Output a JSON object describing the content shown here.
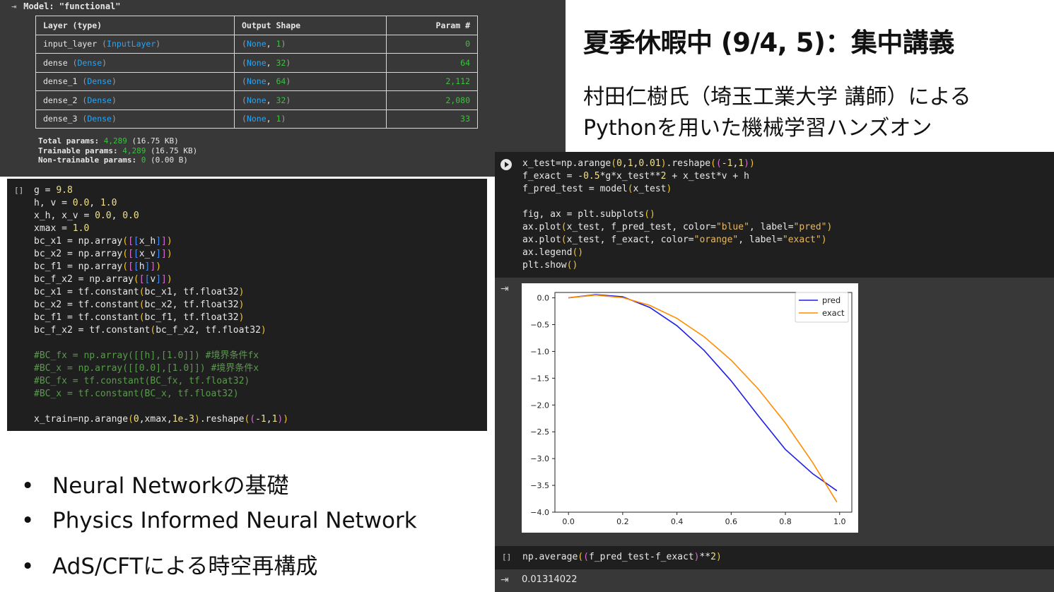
{
  "model_summary": {
    "output_icon": "output-toggle-icon",
    "header": "Model: \"functional\"",
    "columns": [
      "Layer (type)",
      "Output Shape",
      "Param #"
    ],
    "rows": [
      {
        "name": "input_layer",
        "type": "InputLayer",
        "shape_none": "None",
        "shape_dim": "1",
        "params": "0"
      },
      {
        "name": "dense",
        "type": "Dense",
        "shape_none": "None",
        "shape_dim": "32",
        "params": "64"
      },
      {
        "name": "dense_1",
        "type": "Dense",
        "shape_none": "None",
        "shape_dim": "64",
        "params": "2,112"
      },
      {
        "name": "dense_2",
        "type": "Dense",
        "shape_none": "None",
        "shape_dim": "32",
        "params": "2,080"
      },
      {
        "name": "dense_3",
        "type": "Dense",
        "shape_none": "None",
        "shape_dim": "1",
        "params": "33"
      }
    ],
    "totals": [
      {
        "label": "Total params:",
        "value": "4,289",
        "size": "(16.75 KB)"
      },
      {
        "label": "Trainable params:",
        "value": "4,289",
        "size": "(16.75 KB)"
      },
      {
        "label": "Non-trainable params:",
        "value": "0",
        "size": "(0.00 B)"
      }
    ]
  },
  "code_left": {
    "run_marker": "[]",
    "lines": [
      [
        {
          "t": "g = "
        },
        {
          "t": "9.8",
          "c": "n"
        }
      ],
      [
        {
          "t": "h, v = "
        },
        {
          "t": "0.0",
          "c": "n"
        },
        {
          "t": ", "
        },
        {
          "t": "1.0",
          "c": "n"
        }
      ],
      [
        {
          "t": "x_h, x_v = "
        },
        {
          "t": "0.0",
          "c": "n"
        },
        {
          "t": ", "
        },
        {
          "t": "0.0",
          "c": "n"
        }
      ],
      [
        {
          "t": "xmax = "
        },
        {
          "t": "1.0",
          "c": "n"
        }
      ],
      [
        {
          "t": "bc_x1 = np.array"
        },
        {
          "t": "(",
          "c": "p1"
        },
        {
          "t": "[",
          "c": "p2"
        },
        {
          "t": "[",
          "c": "p3"
        },
        {
          "t": "x_h"
        },
        {
          "t": "]",
          "c": "p3"
        },
        {
          "t": "]",
          "c": "p2"
        },
        {
          "t": ")",
          "c": "p1"
        }
      ],
      [
        {
          "t": "bc_x2 = np.array"
        },
        {
          "t": "(",
          "c": "p1"
        },
        {
          "t": "[",
          "c": "p2"
        },
        {
          "t": "[",
          "c": "p3"
        },
        {
          "t": "x_v"
        },
        {
          "t": "]",
          "c": "p3"
        },
        {
          "t": "]",
          "c": "p2"
        },
        {
          "t": ")",
          "c": "p1"
        }
      ],
      [
        {
          "t": "bc_f1 = np.array"
        },
        {
          "t": "(",
          "c": "p1"
        },
        {
          "t": "[",
          "c": "p2"
        },
        {
          "t": "[",
          "c": "p3"
        },
        {
          "t": "h"
        },
        {
          "t": "]",
          "c": "p3"
        },
        {
          "t": "]",
          "c": "p2"
        },
        {
          "t": ")",
          "c": "p1"
        }
      ],
      [
        {
          "t": "bc_f_x2 = np.array"
        },
        {
          "t": "(",
          "c": "p1"
        },
        {
          "t": "[",
          "c": "p2"
        },
        {
          "t": "[",
          "c": "p3"
        },
        {
          "t": "v"
        },
        {
          "t": "]",
          "c": "p3"
        },
        {
          "t": "]",
          "c": "p2"
        },
        {
          "t": ")",
          "c": "p1"
        }
      ],
      [
        {
          "t": "bc_x1 = tf.constant"
        },
        {
          "t": "(",
          "c": "p1"
        },
        {
          "t": "bc_x1, tf.float32"
        },
        {
          "t": ")",
          "c": "p1"
        }
      ],
      [
        {
          "t": "bc_x2 = tf.constant"
        },
        {
          "t": "(",
          "c": "p1"
        },
        {
          "t": "bc_x2, tf.float32"
        },
        {
          "t": ")",
          "c": "p1"
        }
      ],
      [
        {
          "t": "bc_f1 = tf.constant"
        },
        {
          "t": "(",
          "c": "p1"
        },
        {
          "t": "bc_f1, tf.float32"
        },
        {
          "t": ")",
          "c": "p1"
        }
      ],
      [
        {
          "t": "bc_f_x2 = tf.constant"
        },
        {
          "t": "(",
          "c": "p1"
        },
        {
          "t": "bc_f_x2, tf.float32"
        },
        {
          "t": ")",
          "c": "p1"
        }
      ],
      [],
      [
        {
          "t": "#BC_fx = np.array([[h],[1.0]]) #境界条件fx",
          "c": "cm"
        }
      ],
      [
        {
          "t": "#BC_x = np.array([[0.0],[1.0]]) #境界条件x",
          "c": "cm"
        }
      ],
      [
        {
          "t": "#BC_fx = tf.constant(BC_fx, tf.float32)",
          "c": "cm"
        }
      ],
      [
        {
          "t": "#BC_x = tf.constant(BC_x, tf.float32)",
          "c": "cm"
        }
      ],
      [],
      [
        {
          "t": "x_train=np.arange"
        },
        {
          "t": "(",
          "c": "p1"
        },
        {
          "t": "0",
          "c": "n"
        },
        {
          "t": ",xmax,"
        },
        {
          "t": "1e-3",
          "c": "n"
        },
        {
          "t": ")",
          "c": "p1"
        },
        {
          "t": ".reshape"
        },
        {
          "t": "(",
          "c": "p1"
        },
        {
          "t": "(",
          "c": "p2"
        },
        {
          "t": "-1",
          "c": "n"
        },
        {
          "t": ","
        },
        {
          "t": "1",
          "c": "n"
        },
        {
          "t": ")",
          "c": "p2"
        },
        {
          "t": ")",
          "c": "p1"
        }
      ]
    ]
  },
  "title": {
    "main": "夏季休暇中 (9/4, 5)：集中講義",
    "sub1": "村田仁樹氏（埼玉工業大学 講師）による",
    "sub2": "Pythonを用いた機械学習ハンズオン"
  },
  "code_right": {
    "run_icon": "play-icon",
    "lines": [
      [
        {
          "t": "x_test=np.arange"
        },
        {
          "t": "(",
          "c": "p1"
        },
        {
          "t": "0",
          "c": "n"
        },
        {
          "t": ","
        },
        {
          "t": "1",
          "c": "n"
        },
        {
          "t": ","
        },
        {
          "t": "0.01",
          "c": "n"
        },
        {
          "t": ")",
          "c": "p1"
        },
        {
          "t": ".reshape"
        },
        {
          "t": "(",
          "c": "p1"
        },
        {
          "t": "(",
          "c": "p2"
        },
        {
          "t": "-1",
          "c": "n"
        },
        {
          "t": ","
        },
        {
          "t": "1",
          "c": "n"
        },
        {
          "t": ")",
          "c": "p2"
        },
        {
          "t": ")",
          "c": "p1"
        }
      ],
      [
        {
          "t": "f_exact = -"
        },
        {
          "t": "0.5",
          "c": "n"
        },
        {
          "t": "*g*x_test**"
        },
        {
          "t": "2",
          "c": "n"
        },
        {
          "t": " + x_test*v + h"
        }
      ],
      [
        {
          "t": "f_pred_test = model"
        },
        {
          "t": "(",
          "c": "p1"
        },
        {
          "t": "x_test"
        },
        {
          "t": ")",
          "c": "p1"
        }
      ],
      [],
      [
        {
          "t": "fig, ax = plt.subplots"
        },
        {
          "t": "()",
          "c": "p1"
        }
      ],
      [
        {
          "t": "ax.plot"
        },
        {
          "t": "(",
          "c": "p1"
        },
        {
          "t": "x_test, f_pred_test, color="
        },
        {
          "t": "\"blue\"",
          "c": "s"
        },
        {
          "t": ", label="
        },
        {
          "t": "\"pred\"",
          "c": "s"
        },
        {
          "t": ")",
          "c": "p1"
        }
      ],
      [
        {
          "t": "ax.plot"
        },
        {
          "t": "(",
          "c": "p1"
        },
        {
          "t": "x_test, f_exact, color="
        },
        {
          "t": "\"orange\"",
          "c": "s"
        },
        {
          "t": ", label="
        },
        {
          "t": "\"exact\"",
          "c": "s"
        },
        {
          "t": ")",
          "c": "p1"
        }
      ],
      [
        {
          "t": "ax.legend"
        },
        {
          "t": "()",
          "c": "p1"
        }
      ],
      [
        {
          "t": "plt.show"
        },
        {
          "t": "()",
          "c": "p1"
        }
      ]
    ],
    "output_icon": "output-toggle-icon"
  },
  "chart_data": {
    "type": "line",
    "title": "",
    "xlabel": "",
    "ylabel": "",
    "xlim": [
      -0.05,
      1.045
    ],
    "ylim": [
      -4.0,
      0.1
    ],
    "x_ticks": [
      "0.0",
      "0.2",
      "0.4",
      "0.6",
      "0.8",
      "1.0"
    ],
    "y_ticks": [
      "0.0",
      "−0.5",
      "−1.0",
      "−1.5",
      "−2.0",
      "−2.5",
      "−3.0",
      "−3.5",
      "−4.0"
    ],
    "x_tick_values": [
      0.0,
      0.2,
      0.4,
      0.6,
      0.8,
      1.0
    ],
    "y_tick_values": [
      0.0,
      -0.5,
      -1.0,
      -1.5,
      -2.0,
      -2.5,
      -3.0,
      -3.5,
      -4.0
    ],
    "legend_position": "top-right",
    "grid": false,
    "series": [
      {
        "name": "pred",
        "color": "#1f1fe6",
        "x": [
          0.0,
          0.1,
          0.2,
          0.3,
          0.4,
          0.5,
          0.6,
          0.7,
          0.8,
          0.9,
          0.99
        ],
        "y": [
          0.0,
          0.06,
          0.02,
          -0.18,
          -0.52,
          -0.98,
          -1.55,
          -2.2,
          -2.83,
          -3.28,
          -3.6
        ]
      },
      {
        "name": "exact",
        "color": "#ff8c00",
        "x": [
          0.0,
          0.1,
          0.2,
          0.3,
          0.4,
          0.5,
          0.6,
          0.7,
          0.8,
          0.9,
          0.99
        ],
        "y": [
          0.0,
          0.051,
          0.004,
          -0.141,
          -0.384,
          -0.725,
          -1.164,
          -1.701,
          -2.336,
          -3.069,
          -3.813
        ]
      }
    ]
  },
  "cell2": {
    "run_marker": "[]",
    "code": [
      {
        "t": "np.average"
      },
      {
        "t": "(",
        "c": "p1"
      },
      {
        "t": "(",
        "c": "p2"
      },
      {
        "t": "f_pred_test-f_exact"
      },
      {
        "t": ")",
        "c": "p2"
      },
      {
        "t": "**"
      },
      {
        "t": "2",
        "c": "n"
      },
      {
        "t": ")",
        "c": "p1"
      }
    ],
    "output_icon": "output-toggle-icon",
    "output_value": "0.01314022"
  },
  "bullets": {
    "marker": "•",
    "items": [
      "Neural Networkの基礎",
      "Physics Informed Neural Network",
      "AdS/CFTによる時空再構成"
    ]
  }
}
